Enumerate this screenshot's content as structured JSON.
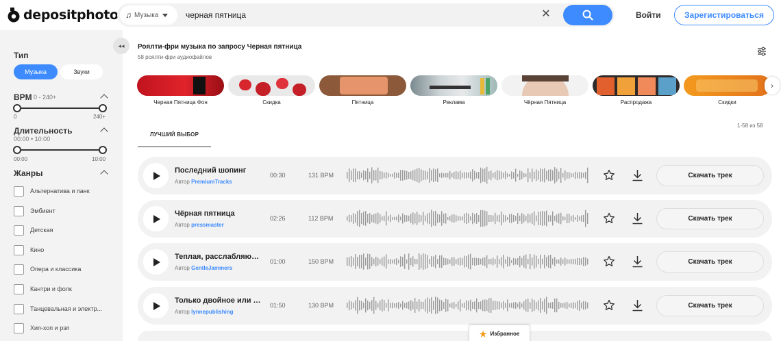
{
  "header": {
    "logo_text": "depositphotos",
    "search_scope": "Музыка",
    "search_value": "черная пятница",
    "login_label": "Войти",
    "register_label": "Зарегистироваться"
  },
  "sidebar": {
    "type_title": "Тип",
    "type_options": [
      "Музыка",
      "Звуки"
    ],
    "bpm_title": "BPM",
    "bpm_range": "0 - 240+",
    "bpm_min": "0",
    "bpm_max": "240+",
    "duration_title": "Длительность",
    "duration_range": "00:00 • 10:00",
    "duration_min": "00:00",
    "duration_max": "10:00",
    "genres_title": "Жанры",
    "genres": [
      "Альтернатива и панк",
      "Эмбиент",
      "Детская",
      "Кино",
      "Опера и классика",
      "Кантри и фолк",
      "Танцевальная и электр...",
      "Хип-хоп и рэп"
    ]
  },
  "main": {
    "title": "Роялти-фри музыка по запросу Черная пятница",
    "subtitle": "58 роялти-фри аудиофайлов",
    "categories": [
      {
        "label": "Черная Пятница Фон",
        "icon": "black-friday-tag-thumbnail"
      },
      {
        "label": "Скидка",
        "icon": "hearts-balloons-thumbnail"
      },
      {
        "label": "Пятница",
        "icon": "good-morning-friday-thumbnail"
      },
      {
        "label": "Реклама",
        "icon": "advertising-desk-thumbnail"
      },
      {
        "label": "Чёрная Пятница",
        "icon": "woman-face-thumbnail"
      },
      {
        "label": "Распродажа",
        "icon": "sale-letters-thumbnail"
      },
      {
        "label": "Скидки",
        "icon": "percent-discount-thumbnail"
      }
    ],
    "tab_label": "ЛУЧШИЙ ВЫБОР",
    "result_count": "1-58 из 58",
    "author_prefix": "Автор",
    "download_label": "Скачать трек",
    "tracks": [
      {
        "title": "Последний шопинг",
        "author": "PremiumTracks",
        "duration": "00:30",
        "bpm": "131 BPM"
      },
      {
        "title": "Чёрная пятница",
        "author": "pressmaster",
        "duration": "02:26",
        "bpm": "112 BPM"
      },
      {
        "title": "Теплая, расслабляющая...",
        "author": "GentleJammers",
        "duration": "01:00",
        "bpm": "150 BPM"
      },
      {
        "title": "Только двойное или ничего",
        "author": "lynnepublishing",
        "duration": "01:50",
        "bpm": "130 BPM"
      }
    ]
  },
  "favorites_label": "Избранное",
  "colors": {
    "accent": "#3d8bff",
    "favorite_star": "#f39a17"
  }
}
